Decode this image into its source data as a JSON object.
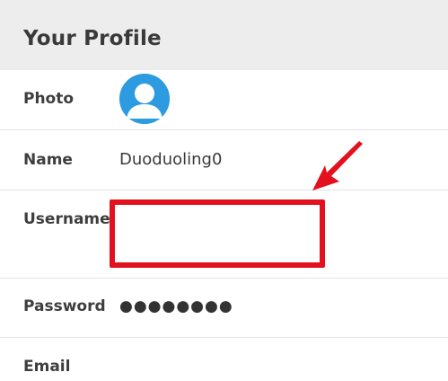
{
  "header": {
    "title": "Your Profile"
  },
  "profile": {
    "photo": {
      "label": "Photo",
      "avatar_icon": "default-user-avatar-icon",
      "avatar_color": "#2c9be0"
    },
    "name": {
      "label": "Name",
      "value": "Duoduoling0"
    },
    "username": {
      "label": "Username",
      "value": "",
      "highlight_color": "#e3101d"
    },
    "password": {
      "label": "Password",
      "value": "●●●●●●●●"
    },
    "email": {
      "label": "Email",
      "value": ""
    }
  },
  "annotation": {
    "arrow_icon": "red-arrow-icon",
    "color": "#e3101d"
  }
}
